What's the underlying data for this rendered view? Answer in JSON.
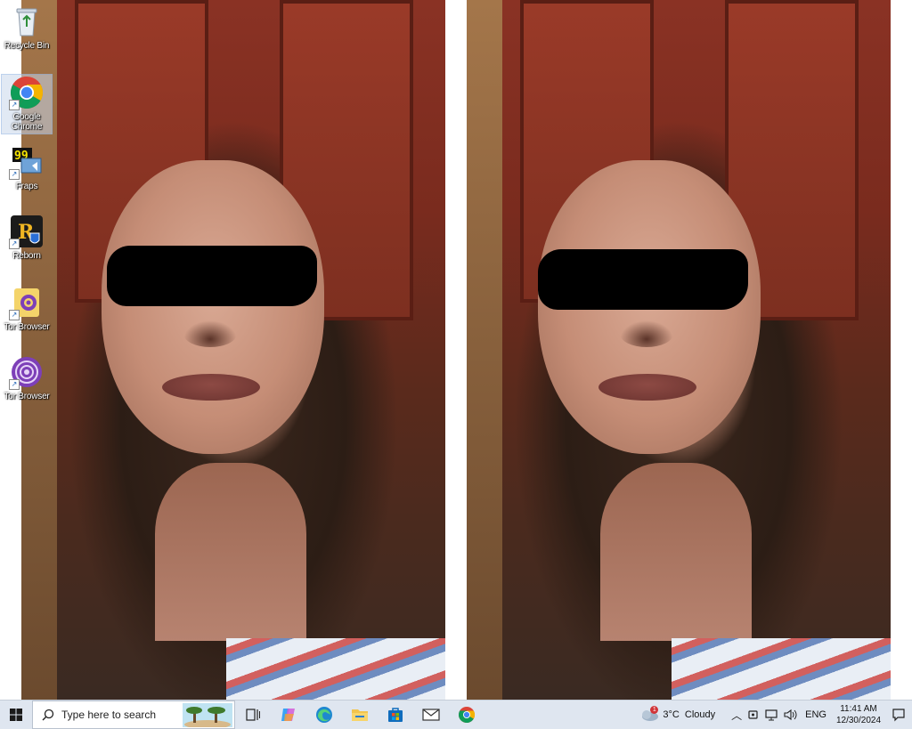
{
  "desktop": {
    "icons": [
      {
        "label": "Recycle Bin",
        "icon": "recycle-bin-icon"
      },
      {
        "label": "Google Chrome",
        "icon": "chrome-icon"
      },
      {
        "label": "Fraps",
        "icon": "fraps-icon"
      },
      {
        "label": "Reborn",
        "icon": "reborn-icon"
      },
      {
        "label": "Tor Browser",
        "icon": "tor-browser-icon"
      },
      {
        "label": "Tor Browser",
        "icon": "tor-browser-icon"
      }
    ]
  },
  "taskbar": {
    "search_placeholder": "Type here to search",
    "weather_text": "3°C  Cloudy",
    "weather_badge": "1",
    "language": "ENG",
    "time": "11:41 AM",
    "date": "12/30/2024"
  }
}
